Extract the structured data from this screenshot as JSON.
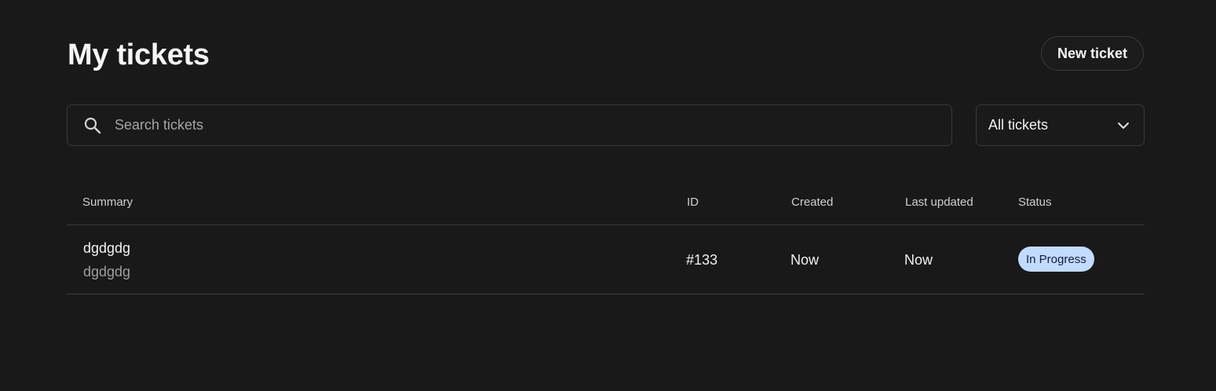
{
  "header": {
    "title": "My tickets",
    "new_ticket_label": "New ticket"
  },
  "search": {
    "icon": "search-icon",
    "placeholder": "Search tickets",
    "value": ""
  },
  "filter": {
    "selected": "All tickets",
    "icon": "chevron-down-icon"
  },
  "table": {
    "columns": [
      "Summary",
      "ID",
      "Created",
      "Last updated",
      "Status"
    ],
    "rows": [
      {
        "summary_title": "dgdgdg",
        "summary_description": "dgdgdg",
        "id": "#133",
        "created": "Now",
        "last_updated": "Now",
        "status": "In Progress"
      }
    ]
  },
  "colors": {
    "background": "#191919",
    "border": "#3a3a3a",
    "status_in_progress_bg": "#c2dbfe",
    "status_in_progress_text": "#11203a"
  }
}
